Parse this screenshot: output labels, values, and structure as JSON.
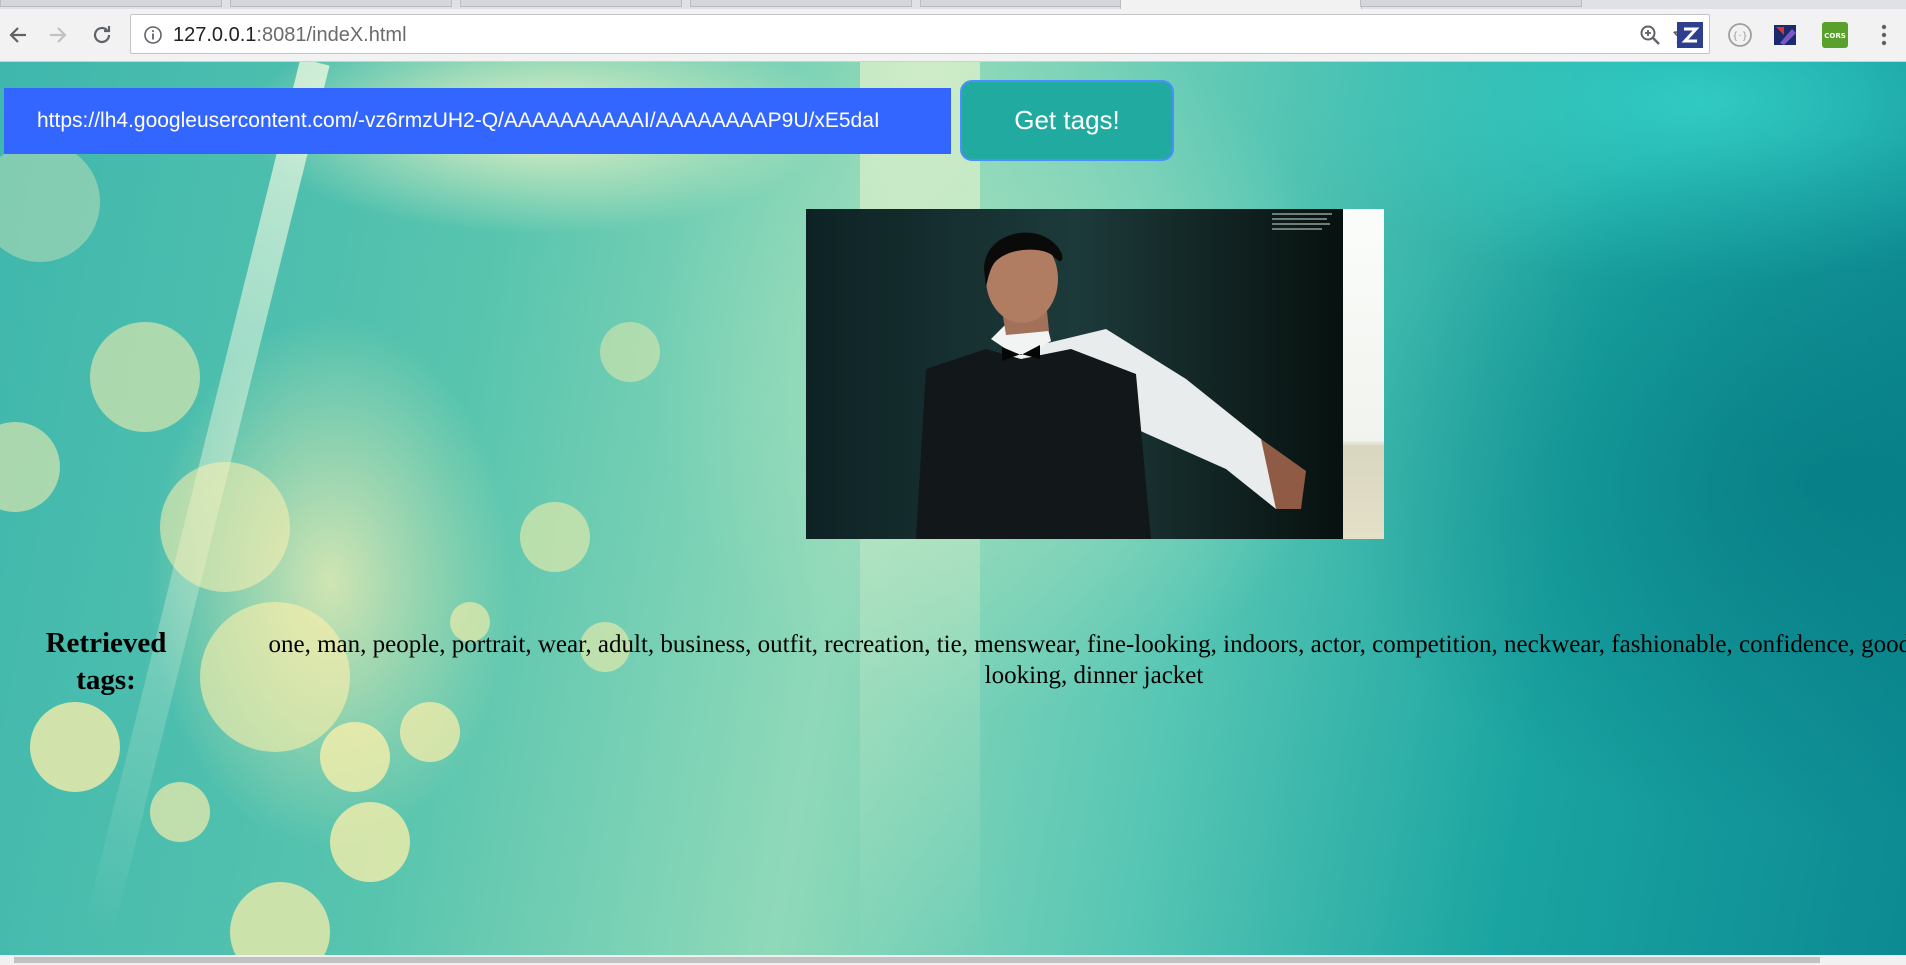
{
  "browser": {
    "url_host": "127.0.0.1",
    "url_rest": ":8081/indeX.html",
    "icons": {
      "back": "arrow-left-icon",
      "forward": "arrow-right-icon",
      "reload": "reload-icon",
      "info": "info-icon",
      "zoom": "zoom-icon",
      "bookmark": "star-icon",
      "menu": "kebab-menu-icon"
    },
    "extensions": [
      {
        "name": "z-extension-icon",
        "glyph": "Z",
        "color": "#2f3f8f"
      },
      {
        "name": "json-viewer-icon",
        "glyph": "{ }",
        "color": "#9e9e9e"
      },
      {
        "name": "color-picker-icon",
        "glyph": "",
        "color": "#1a2a6c"
      },
      {
        "name": "cors-extension-icon",
        "glyph": "CORS",
        "color": "#5aa02c"
      }
    ]
  },
  "form": {
    "url_value": "https://lh4.googleusercontent.com/-vz6rmzUH2-Q/AAAAAAAAAAI/AAAAAAAAP9U/xE5daI",
    "button_label": "Get tags!",
    "button_color": "#21aaa0",
    "input_color": "#3366ff"
  },
  "results": {
    "label": "Retrieved tags:",
    "tags_text": "one, man, people, portrait, wear, adult, business, outfit, recreation, tie, menswear, fine-looking, indoors, actor, competition, neckwear, fashionable, confidence, good-looking, dinner jacket"
  }
}
